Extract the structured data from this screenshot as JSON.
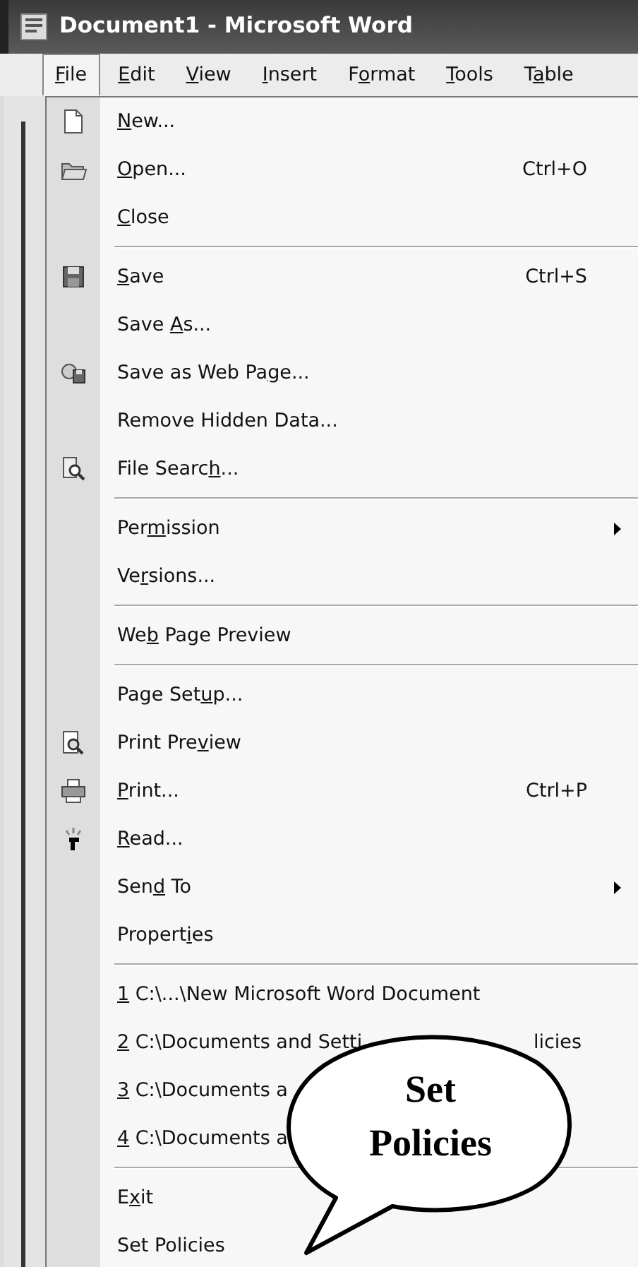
{
  "window": {
    "title": "Document1 - Microsoft Word"
  },
  "menu_bar": [
    {
      "key": "F",
      "post": "ile",
      "selected": true
    },
    {
      "key": "E",
      "post": "dit",
      "selected": false
    },
    {
      "key": "V",
      "post": "iew",
      "selected": false
    },
    {
      "key": "I",
      "post": "nsert",
      "selected": false
    },
    {
      "pre": "F",
      "key": "o",
      "post": "rmat",
      "selected": false
    },
    {
      "key": "T",
      "post": "ools",
      "selected": false
    },
    {
      "pre": "T",
      "key": "a",
      "post": "ble",
      "selected": false
    }
  ],
  "file_menu": {
    "groups": [
      [
        {
          "key": "N",
          "post": "ew...",
          "submenu": false
        },
        {
          "key": "O",
          "post": "pen...",
          "shortcut": "Ctrl+O",
          "submenu": false
        },
        {
          "key": "C",
          "post": "lose",
          "submenu": false
        }
      ],
      [
        {
          "key": "S",
          "post": "ave",
          "shortcut": "Ctrl+S",
          "submenu": false
        },
        {
          "pre": "Save ",
          "key": "A",
          "post": "s...",
          "submenu": false
        },
        {
          "pre": "Save as Web Pa",
          "key": "g",
          "post": "e...",
          "submenu": false
        },
        {
          "pre": "Remove Hidden Data...",
          "submenu": false
        },
        {
          "pre": "File Searc",
          "key": "h",
          "post": "...",
          "submenu": false
        }
      ],
      [
        {
          "pre": "Per",
          "key": "m",
          "post": "ission",
          "submenu": true
        },
        {
          "pre": "Ve",
          "key": "r",
          "post": "sions...",
          "submenu": false
        }
      ],
      [
        {
          "pre": "We",
          "key": "b",
          "post": " Page Preview",
          "submenu": false
        }
      ],
      [
        {
          "pre": "Page Set",
          "key": "u",
          "post": "p...",
          "submenu": false
        },
        {
          "pre": "Print Pre",
          "key": "v",
          "post": "iew",
          "submenu": false
        },
        {
          "key": "P",
          "post": "rint...",
          "shortcut": "Ctrl+P",
          "submenu": false
        },
        {
          "key": "R",
          "post": "ead...",
          "submenu": false
        },
        {
          "pre": "Sen",
          "key": "d",
          "post": " To",
          "submenu": true
        },
        {
          "pre": "Propert",
          "key": "i",
          "post": "es",
          "submenu": false
        }
      ],
      [
        {
          "key": "1",
          "post": " C:\\...\\New Microsoft Word Document",
          "submenu": false
        },
        {
          "key": "2",
          "post": " C:\\Documents and Setti",
          "tail": "licies",
          "submenu": false
        },
        {
          "key": "3",
          "post": " C:\\Documents a",
          "submenu": false
        },
        {
          "key": "4",
          "post": " C:\\Documents a",
          "submenu": false
        }
      ],
      [
        {
          "pre": "E",
          "key": "x",
          "post": "it",
          "submenu": false
        },
        {
          "pre": "Set Policies",
          "submenu": false
        }
      ]
    ]
  },
  "callout": {
    "text": "Set Policies"
  }
}
